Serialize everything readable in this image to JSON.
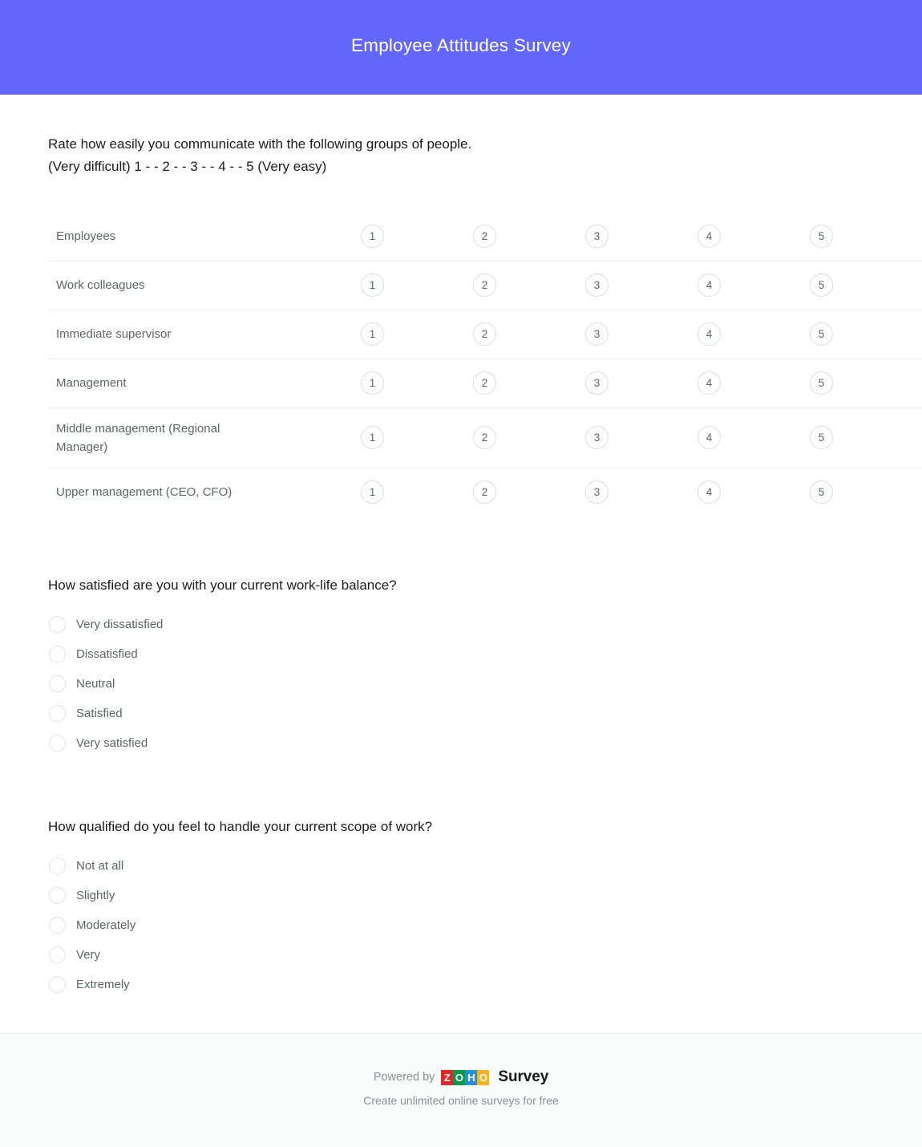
{
  "header": {
    "title": "Employee Attitudes Survey",
    "background_color": "#6366fb",
    "title_color": "#ffffff"
  },
  "questions": [
    {
      "type": "matrix",
      "prompt_line1": "Rate how easily you communicate with the following groups of people.",
      "prompt_line2": "(Very difficult) 1 - - 2 - - 3 - - 4 - - 5 (Very easy)",
      "scale": [
        "1",
        "2",
        "3",
        "4",
        "5"
      ],
      "rows": [
        "Employees",
        "Work colleagues",
        "Immediate supervisor",
        "Management",
        "Middle management (Regional Manager)",
        "Upper management (CEO, CFO)"
      ]
    },
    {
      "type": "radio",
      "prompt": "How satisfied are you with your current work-life balance?",
      "options": [
        "Very dissatisfied",
        "Dissatisfied",
        "Neutral",
        "Satisfied",
        "Very satisfied"
      ]
    },
    {
      "type": "radio",
      "prompt": "How qualified do you feel to handle your current scope of work?",
      "options": [
        "Not at all",
        "Slightly",
        "Moderately",
        "Very",
        "Extremely"
      ]
    }
  ],
  "footer": {
    "powered_by": "Powered by",
    "brand_tiles": [
      "Z",
      "O",
      "H",
      "O"
    ],
    "brand_product": "Survey",
    "tagline": "Create unlimited online surveys for free",
    "tile_colors": {
      "z": "#e42527",
      "o1": "#089949",
      "h": "#2a8fd4",
      "o2": "#f9b21d"
    }
  }
}
